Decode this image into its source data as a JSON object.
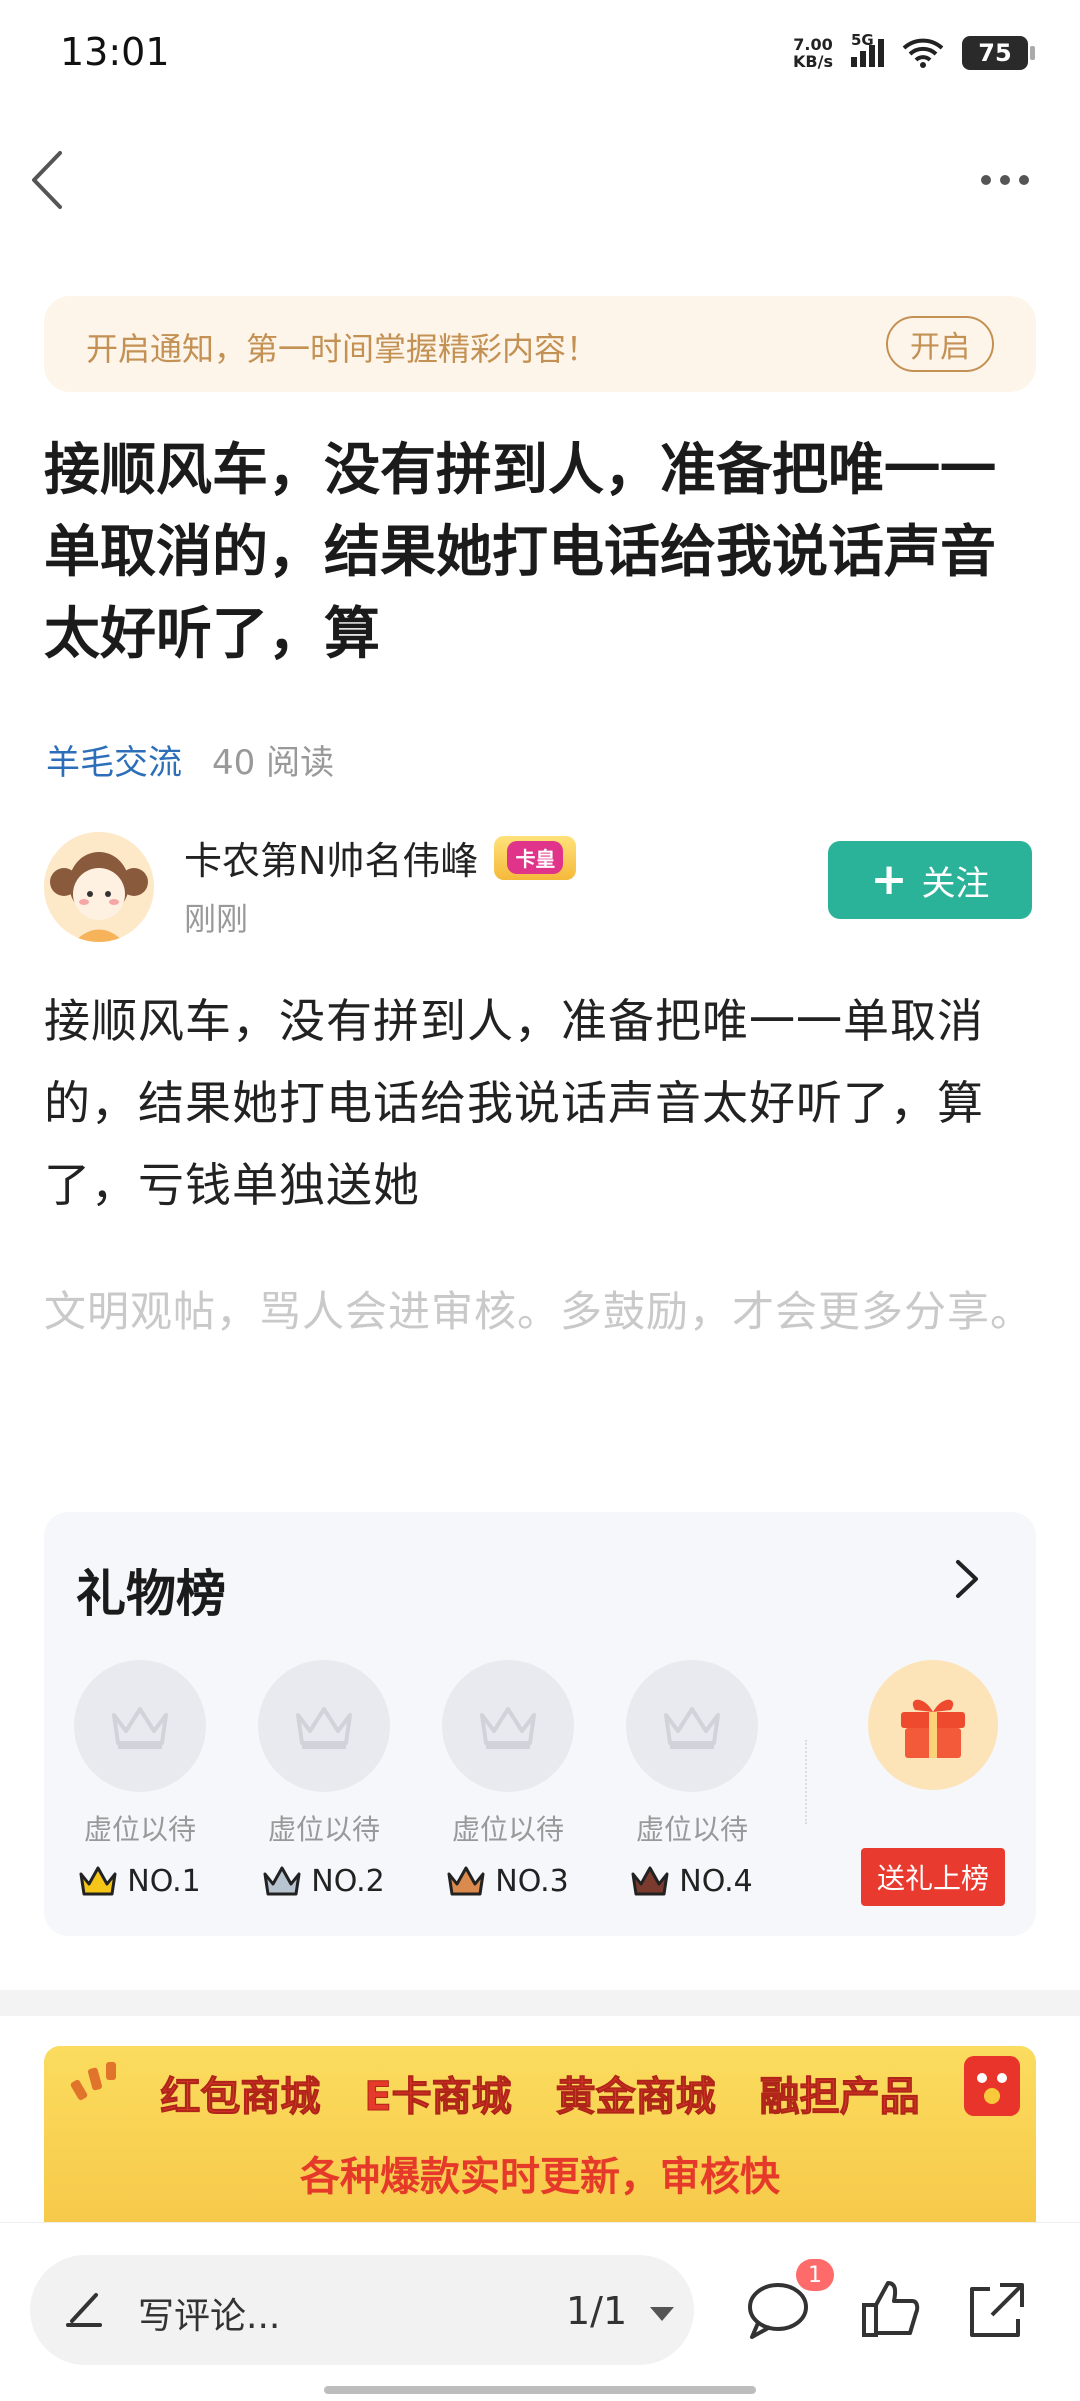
{
  "status_bar": {
    "time": "13:01",
    "net_speed_value": "7.00",
    "net_speed_unit": "KB/s",
    "network": "5G",
    "battery": "75"
  },
  "notification": {
    "text": "开启通知，第一时间掌握精彩内容！",
    "button_label": "开启"
  },
  "post": {
    "title": "接顺风车，没有拼到人，准备把唯一一单取消的，结果她打电话给我说话声音太好听了，算",
    "category": "羊毛交流",
    "reads": "40 阅读",
    "author_name": "卡农第N帅名伟峰",
    "author_badge": "卡皇",
    "time": "刚刚",
    "follow_label": "关注",
    "body": "接顺风车，没有拼到人，准备把唯一一单取消的，结果她打电话给我说话声音太好听了，算了，亏钱单独送她",
    "hint": "文明观帖，骂人会进审核。多鼓励，才会更多分享。"
  },
  "gift_board": {
    "title": "礼物榜",
    "slots": [
      {
        "label": "虚位以待",
        "rank": "NO.1",
        "crown_color": "#f5c518"
      },
      {
        "label": "虚位以待",
        "rank": "NO.2",
        "crown_color": "#b8c4d0"
      },
      {
        "label": "虚位以待",
        "rank": "NO.3",
        "crown_color": "#d98a4c"
      },
      {
        "label": "虚位以待",
        "rank": "NO.4",
        "crown_color": "#7a3b2e"
      }
    ],
    "send_label": "送礼上榜"
  },
  "banner": {
    "items": [
      "红包商城",
      "E卡商城",
      "黄金商城",
      "融担产品"
    ],
    "subtitle": "各种爆款实时更新，审核快"
  },
  "bottom_bar": {
    "comment_placeholder": "写评论...",
    "page_indicator": "1/1",
    "comment_count": "1"
  },
  "colors": {
    "accent_green": "#2bb39a",
    "link_blue": "#2c6fb8",
    "notify_gold": "#c49154",
    "gift_red": "#e93a30"
  }
}
